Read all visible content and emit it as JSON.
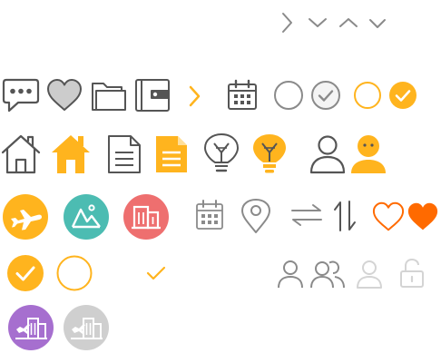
{
  "sheet": {
    "title": ""
  },
  "colors": {
    "gray": "#8a8a8a",
    "dark": "#555555",
    "amber": "#ffb41e",
    "teal": "#4cbcb2",
    "coral": "#ee6f6f",
    "purple": "#a66fcf",
    "light_gray": "#cfcfcf",
    "faint": "#d4d4d4",
    "orange": "#ff6a00",
    "heart_fill": "#cccccc",
    "check_fill": "#f4f4f4",
    "white": "#ffffff"
  },
  "icons": [
    {
      "name": "chevron-right-icon",
      "interactable": true
    },
    {
      "name": "chevron-down-icon",
      "interactable": true
    },
    {
      "name": "chevron-up-icon",
      "interactable": true
    },
    {
      "name": "chevron-down-small-icon",
      "interactable": true
    },
    {
      "name": "chat-bubble-icon",
      "interactable": false
    },
    {
      "name": "heart-filled-gray-icon",
      "interactable": false
    },
    {
      "name": "folder-icon",
      "interactable": false
    },
    {
      "name": "wallet-icon",
      "interactable": false
    },
    {
      "name": "chevron-right-amber-icon",
      "interactable": true
    },
    {
      "name": "calendar-icon",
      "interactable": false
    },
    {
      "name": "radio-unchecked-icon",
      "interactable": true
    },
    {
      "name": "radio-checked-gray-icon",
      "interactable": true
    },
    {
      "name": "radio-unchecked-amber-icon",
      "interactable": true
    },
    {
      "name": "radio-checked-amber-icon",
      "interactable": true
    },
    {
      "name": "home-outline-icon",
      "interactable": false
    },
    {
      "name": "home-filled-icon",
      "interactable": false
    },
    {
      "name": "document-outline-icon",
      "interactable": false
    },
    {
      "name": "document-filled-icon",
      "interactable": false
    },
    {
      "name": "lightbulb-outline-icon",
      "interactable": false
    },
    {
      "name": "lightbulb-filled-icon",
      "interactable": false
    },
    {
      "name": "user-outline-icon",
      "interactable": false
    },
    {
      "name": "user-filled-icon",
      "interactable": false
    },
    {
      "name": "flight-icon",
      "interactable": false
    },
    {
      "name": "landscape-icon",
      "interactable": false
    },
    {
      "name": "building-icon",
      "interactable": false
    },
    {
      "name": "calendar-light-icon",
      "interactable": false
    },
    {
      "name": "location-pin-icon",
      "interactable": false
    },
    {
      "name": "swap-horizontal-icon",
      "interactable": true
    },
    {
      "name": "swap-vertical-icon",
      "interactable": true
    },
    {
      "name": "heart-outline-icon",
      "interactable": true
    },
    {
      "name": "heart-filled-icon",
      "interactable": true
    },
    {
      "name": "checkbox-checked-icon",
      "interactable": true
    },
    {
      "name": "checkbox-unchecked-icon",
      "interactable": true
    },
    {
      "name": "checkmark-icon",
      "interactable": false
    },
    {
      "name": "person-icon",
      "interactable": false
    },
    {
      "name": "people-icon",
      "interactable": false
    },
    {
      "name": "person-disabled-icon",
      "interactable": false
    },
    {
      "name": "unlock-icon",
      "interactable": true
    },
    {
      "name": "hotel-flight-icon",
      "interactable": false
    },
    {
      "name": "hotel-flight-disabled-icon",
      "interactable": false
    }
  ]
}
